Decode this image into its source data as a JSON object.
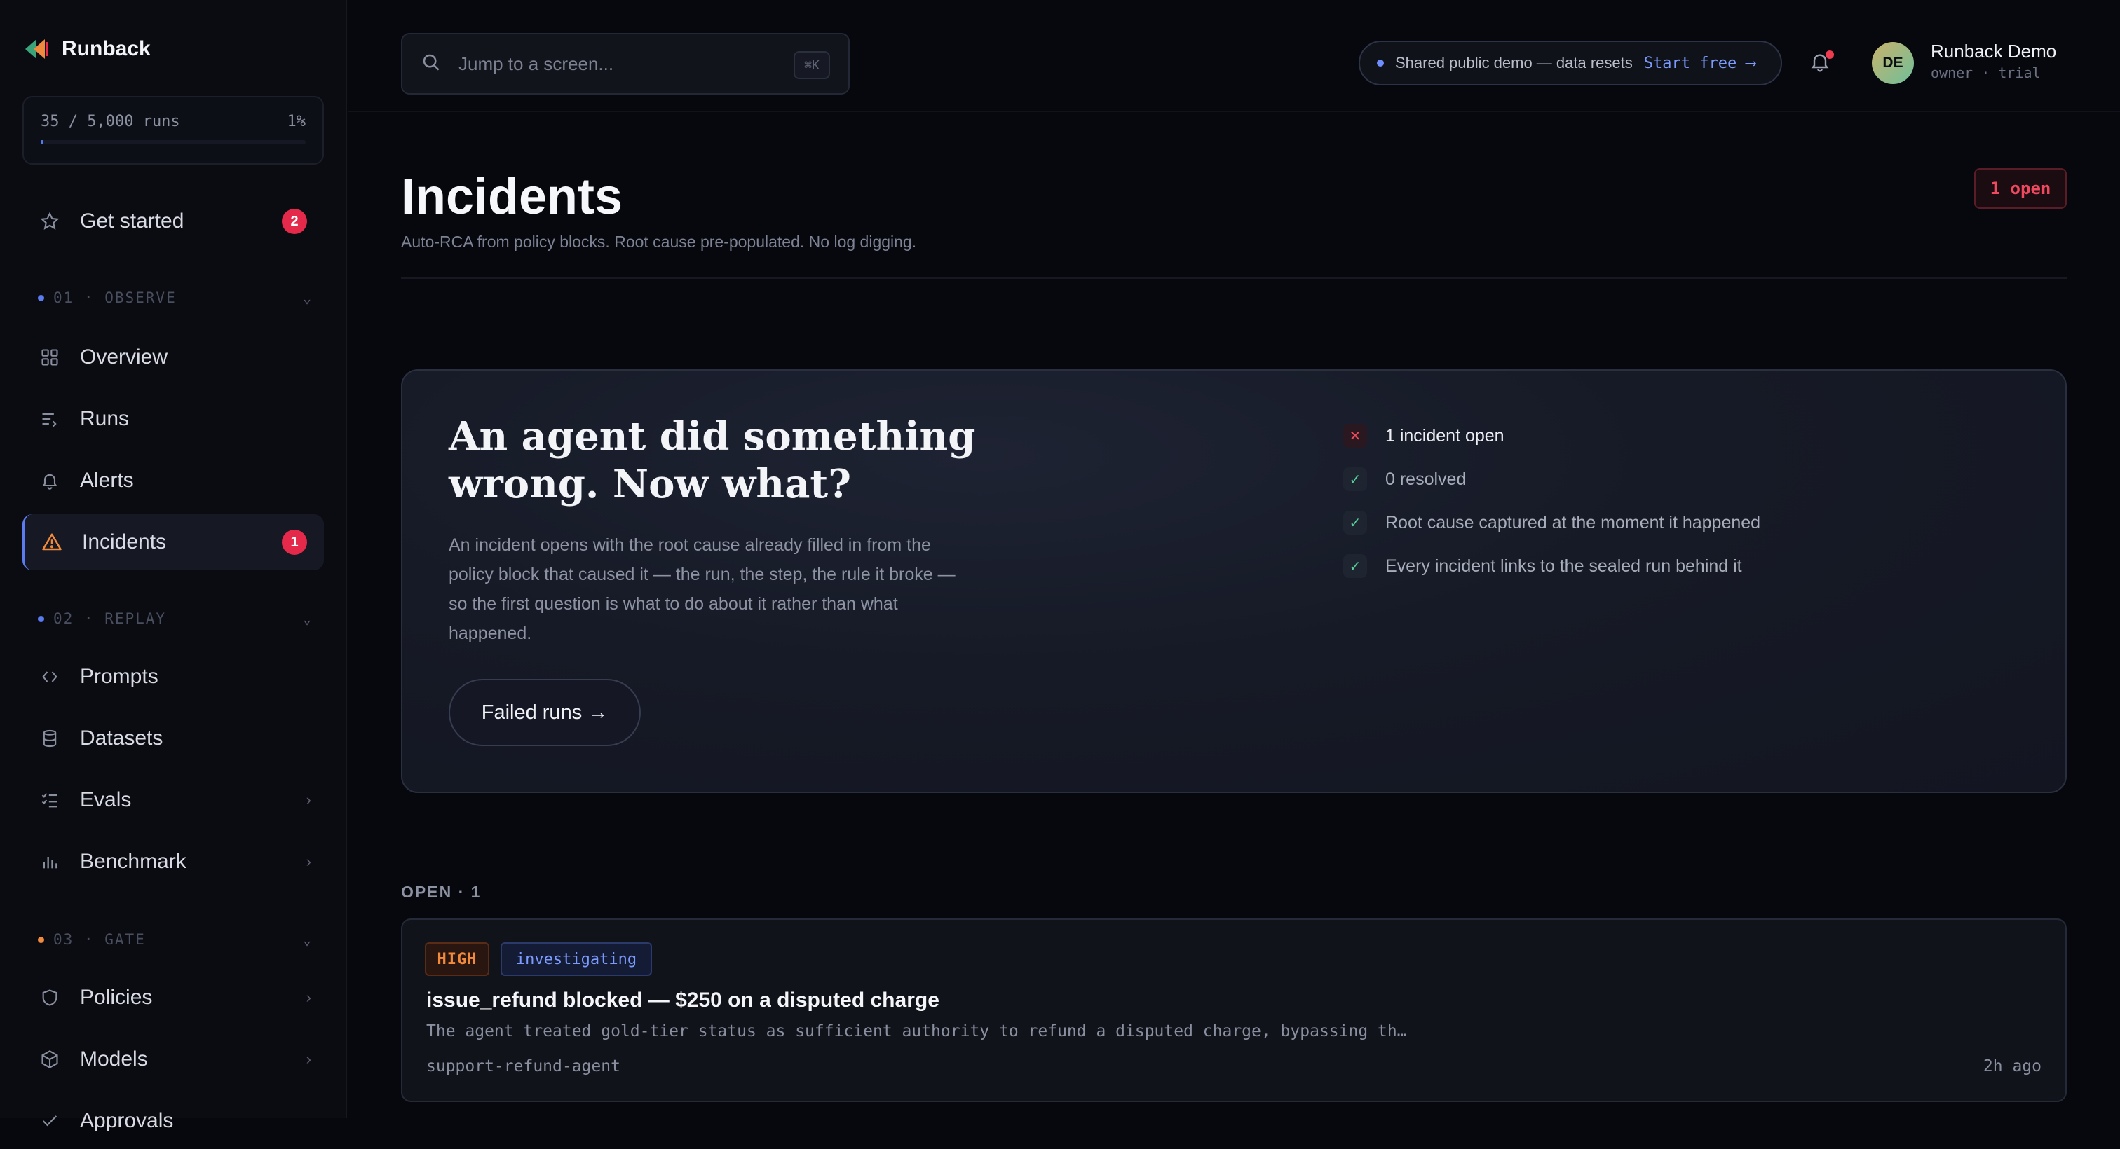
{
  "app": {
    "name": "Runback"
  },
  "quota": {
    "label": "35 / 5,000 runs",
    "percent_label": "1%",
    "fraction": 0.01
  },
  "sidebar": {
    "get_started": {
      "label": "Get started",
      "badge": "2"
    },
    "sections": [
      {
        "label": "01 · OBSERVE",
        "dot_color": "#5b7cf0"
      },
      {
        "label": "02 · REPLAY",
        "dot_color": "#5b7cf0"
      },
      {
        "label": "03 · GATE",
        "dot_color": "#f08a3c"
      }
    ],
    "items": [
      {
        "label": "Overview",
        "icon": "grid-icon"
      },
      {
        "label": "Runs",
        "icon": "list-arrow-icon"
      },
      {
        "label": "Alerts",
        "icon": "bell-icon"
      },
      {
        "label": "Incidents",
        "icon": "warning-icon",
        "badge": "1",
        "active": true
      },
      {
        "label": "Prompts",
        "icon": "code-brackets-icon"
      },
      {
        "label": "Datasets",
        "icon": "database-icon"
      },
      {
        "label": "Evals",
        "icon": "checklist-icon"
      },
      {
        "label": "Benchmark",
        "icon": "bar-chart-icon"
      },
      {
        "label": "Policies",
        "icon": "shield-icon"
      },
      {
        "label": "Models",
        "icon": "cube-icon"
      },
      {
        "label": "Approvals",
        "icon": "approval-icon"
      }
    ]
  },
  "topbar": {
    "search_placeholder": "Jump to a screen...",
    "search_shortcut": "⌘K",
    "demo_notice": "Shared public demo — data resets",
    "demo_cta": "Start free ⟶",
    "user": {
      "initials": "DE",
      "name": "Runback Demo",
      "role": "owner · trial"
    }
  },
  "page": {
    "title": "Incidents",
    "subtitle": "Auto-RCA from policy blocks. Root cause pre-populated. No log digging.",
    "open_badge": "1 open"
  },
  "hero": {
    "title": "An agent did something wrong. Now what?",
    "body": "An incident opens with the root cause already filled in from the policy block that caused it — the run, the step, the rule it broke — so the first question is what to do about it rather than what happened.",
    "button": "Failed runs →",
    "checks": [
      {
        "label": "1 incident open",
        "state": "x"
      },
      {
        "label": "0 resolved",
        "state": "ok"
      },
      {
        "label": "Root cause captured at the moment it happened",
        "state": "ok"
      },
      {
        "label": "Every incident links to the sealed run behind it",
        "state": "ok"
      }
    ]
  },
  "open_section": {
    "label": "OPEN · 1",
    "incidents": [
      {
        "severity": "HIGH",
        "status": "investigating",
        "title": "issue_refund blocked — $250 on a disputed charge",
        "description": "The agent treated gold-tier status as sufficient authority to refund a disputed charge, bypassing th…",
        "agent": "support-refund-agent",
        "time": "2h ago"
      }
    ]
  },
  "colors": {
    "accent": "#5b7cf0",
    "danger": "#e5294b",
    "warning": "#f28a3c",
    "success": "#55d39a"
  }
}
